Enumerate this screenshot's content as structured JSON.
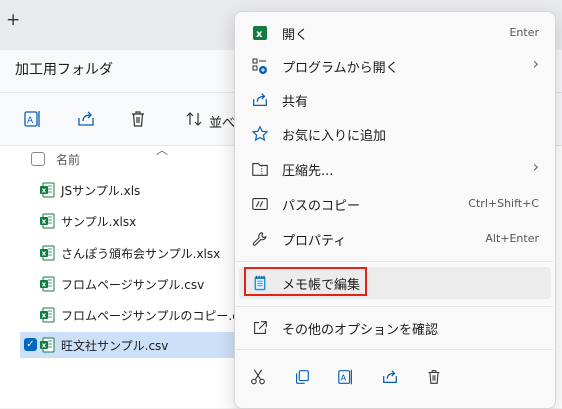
{
  "tabbar": {
    "new_tab": "+"
  },
  "address": {
    "path": "加工用フォルダ"
  },
  "toolbar": {
    "sort_label": "並べ"
  },
  "list": {
    "header_name": "名前",
    "files": [
      {
        "name": "JSサンプル.xls",
        "selected": false
      },
      {
        "name": "サンプル.xlsx",
        "selected": false
      },
      {
        "name": "さんぽう頒布会サンプル.xlsx",
        "selected": false
      },
      {
        "name": "フロムページサンプル.csv",
        "selected": false
      },
      {
        "name": "フロムページサンプルのコピー.csv",
        "selected": false
      },
      {
        "name": "旺文社サンプル.csv",
        "selected": true
      }
    ]
  },
  "menu": {
    "items": [
      {
        "label": "開く",
        "shortcut": "Enter",
        "icon": "excel-icon"
      },
      {
        "label": "プログラムから開く",
        "icon": "open-with-icon",
        "submenu": true
      },
      {
        "label": "共有",
        "icon": "share-icon"
      },
      {
        "label": "お気に入りに追加",
        "icon": "star-icon"
      },
      {
        "label": "圧縮先...",
        "icon": "zip-folder-icon",
        "submenu": true
      },
      {
        "label": "パスのコピー",
        "shortcut": "Ctrl+Shift+C",
        "icon": "copy-path-icon"
      },
      {
        "label": "プロパティ",
        "shortcut": "Alt+Enter",
        "icon": "wrench-icon"
      },
      {
        "label": "メモ帳で編集",
        "icon": "notepad-icon",
        "highlighted": true
      },
      {
        "label": "その他のオプションを確認",
        "icon": "external-icon"
      }
    ],
    "bottom_actions": [
      "cut-icon",
      "copy-icon",
      "rename-icon",
      "share-icon",
      "delete-icon"
    ]
  },
  "colors": {
    "accent": "#0067c0",
    "excel_green": "#107c41",
    "highlight_border": "#e2231a"
  }
}
